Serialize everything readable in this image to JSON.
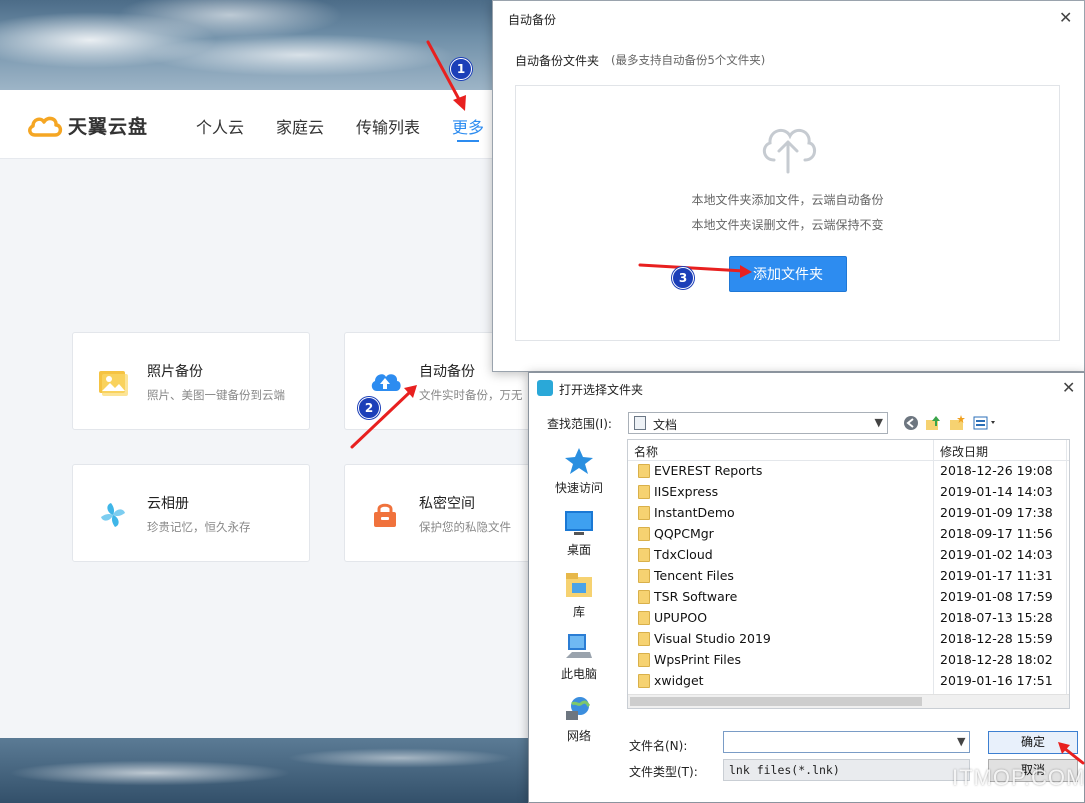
{
  "app": {
    "logo_text": "天翼云盘",
    "nav": [
      "个人云",
      "家庭云",
      "传输列表",
      "更多"
    ],
    "cards": [
      {
        "title": "照片备份",
        "desc": "照片、美图一键备份到云端",
        "icon": "photo-icon",
        "color": "#f5c342"
      },
      {
        "title": "自动备份",
        "desc": "文件实时备份，万无",
        "icon": "cloud-upload-icon",
        "color": "#2d8cf0"
      },
      {
        "title": "云相册",
        "desc": "珍贵记忆，恒久永存",
        "icon": "pinwheel-icon",
        "color": "#3fb6e8"
      },
      {
        "title": "私密空间",
        "desc": "保护您的私隐文件",
        "icon": "lock-icon",
        "color": "#f0723c"
      }
    ]
  },
  "backup_dialog": {
    "title": "自动备份",
    "section_label": "自动备份文件夹",
    "hint": "(最多支持自动备份5个文件夹)",
    "line1": "本地文件夹添加文件，云端自动备份",
    "line2": "本地文件夹误删文件，云端保持不变",
    "add_button": "添加文件夹"
  },
  "open_dialog": {
    "title": "打开选择文件夹",
    "look_in_label": "查找范围(I):",
    "look_in_value": "文档",
    "places": [
      "快速访问",
      "桌面",
      "库",
      "此电脑",
      "网络"
    ],
    "columns": {
      "name": "名称",
      "date": "修改日期"
    },
    "files": [
      {
        "name": "EVEREST Reports",
        "date": "2018-12-26 19:08"
      },
      {
        "name": "IISExpress",
        "date": "2019-01-14 14:03"
      },
      {
        "name": "InstantDemo",
        "date": "2019-01-09 17:38"
      },
      {
        "name": "QQPCMgr",
        "date": "2018-09-17 11:56"
      },
      {
        "name": "TdxCloud",
        "date": "2019-01-02 14:03"
      },
      {
        "name": "Tencent Files",
        "date": "2019-01-17 11:31"
      },
      {
        "name": "TSR Software",
        "date": "2019-01-08 17:59"
      },
      {
        "name": "UPUPOO",
        "date": "2018-07-13 15:28"
      },
      {
        "name": "Visual Studio 2019",
        "date": "2018-12-28 15:59"
      },
      {
        "name": "WpsPrint Files",
        "date": "2018-12-28 18:02"
      },
      {
        "name": "xwidget",
        "date": "2019-01-16 17:51"
      }
    ],
    "file_name_label": "文件名(N):",
    "file_name_value": "",
    "file_type_label": "文件类型(T):",
    "file_type_value": "lnk files(*.lnk)",
    "ok_button": "确定",
    "cancel_button": "取消"
  },
  "annotations": {
    "steps": [
      "1",
      "2",
      "3"
    ],
    "arrow_color": "#e8201f"
  },
  "watermark": "ITMOP.COM",
  "colors": {
    "accent": "#2d8cf0",
    "step_badge": "#1c3fb8"
  }
}
